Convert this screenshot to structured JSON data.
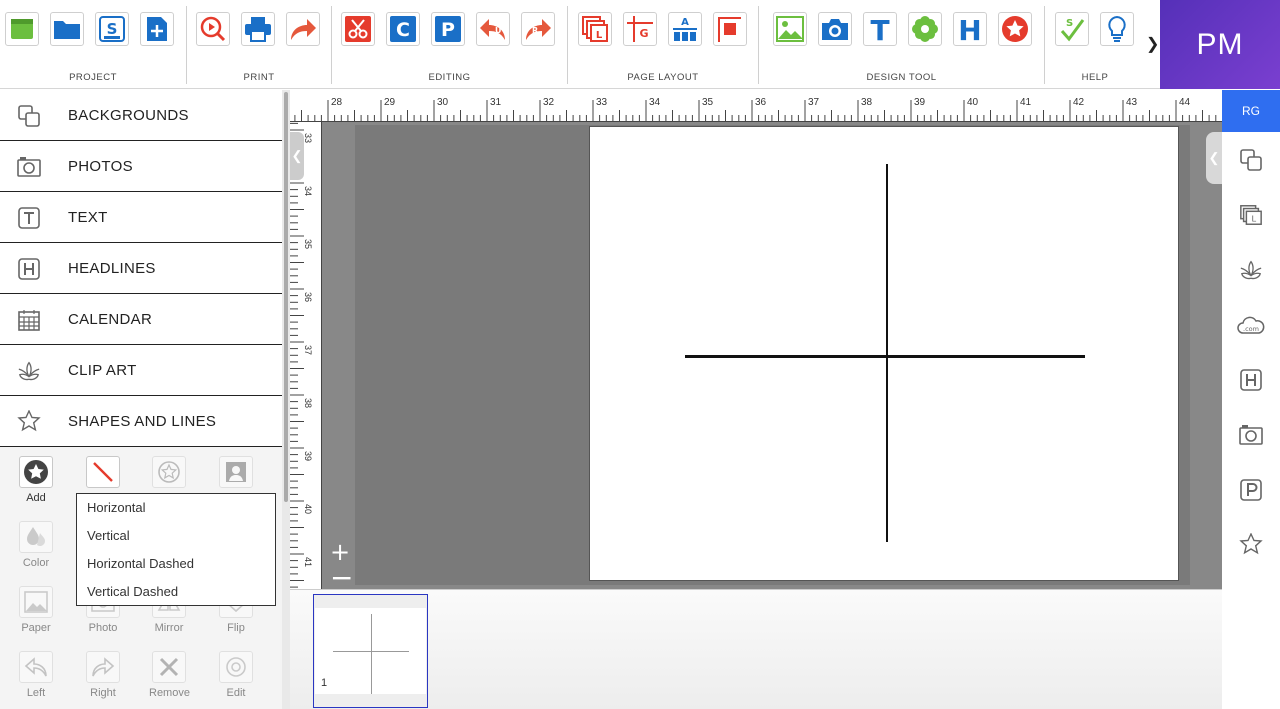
{
  "toolbar": {
    "groups": [
      {
        "label": "PROJECT"
      },
      {
        "label": "PRINT"
      },
      {
        "label": "EDITING"
      },
      {
        "label": "PAGE LAYOUT"
      },
      {
        "label": "DESIGN TOOL"
      },
      {
        "label": "HELP"
      }
    ],
    "more_icon": "chevron-right-icon"
  },
  "brand": {
    "initials": "PM"
  },
  "sidebar": {
    "items": [
      {
        "label": "BACKGROUNDS",
        "icon": "backgrounds-icon"
      },
      {
        "label": "PHOTOS",
        "icon": "camera-icon"
      },
      {
        "label": "TEXT",
        "icon": "text-icon"
      },
      {
        "label": "HEADLINES",
        "icon": "headline-icon"
      },
      {
        "label": "CALENDAR",
        "icon": "calendar-icon"
      },
      {
        "label": "CLIP ART",
        "icon": "lotus-icon"
      },
      {
        "label": "SHAPES AND LINES",
        "icon": "star-icon"
      }
    ]
  },
  "tools": {
    "add": "Add",
    "color": "Color",
    "paper": "Paper",
    "photo": "Photo",
    "mirror": "Mirror",
    "flip": "Flip",
    "left": "Left",
    "right": "Right",
    "remove": "Remove",
    "edit": "Edit"
  },
  "line_menu": {
    "options": [
      "Horizontal",
      "Vertical",
      "Horizontal Dashed",
      "Vertical Dashed"
    ]
  },
  "rulers": {
    "top": [
      "28",
      "29",
      "30",
      "31",
      "32",
      "33",
      "34",
      "35",
      "36",
      "37",
      "38",
      "39",
      "40",
      "41",
      "42",
      "43",
      "44"
    ],
    "left": [
      "33",
      "34",
      "35",
      "36",
      "37",
      "38",
      "39",
      "40",
      "41"
    ]
  },
  "zoom": {
    "in": "+",
    "out": "−"
  },
  "pages": [
    {
      "number": "1"
    }
  ],
  "user": {
    "initials": "RG"
  },
  "colors": {
    "accent_blue": "#2f6ef0",
    "brand_purple": "#6a35c8",
    "icon_red": "#e53b2c",
    "icon_blue": "#1a6fc7",
    "icon_green": "#6cbf3f"
  }
}
